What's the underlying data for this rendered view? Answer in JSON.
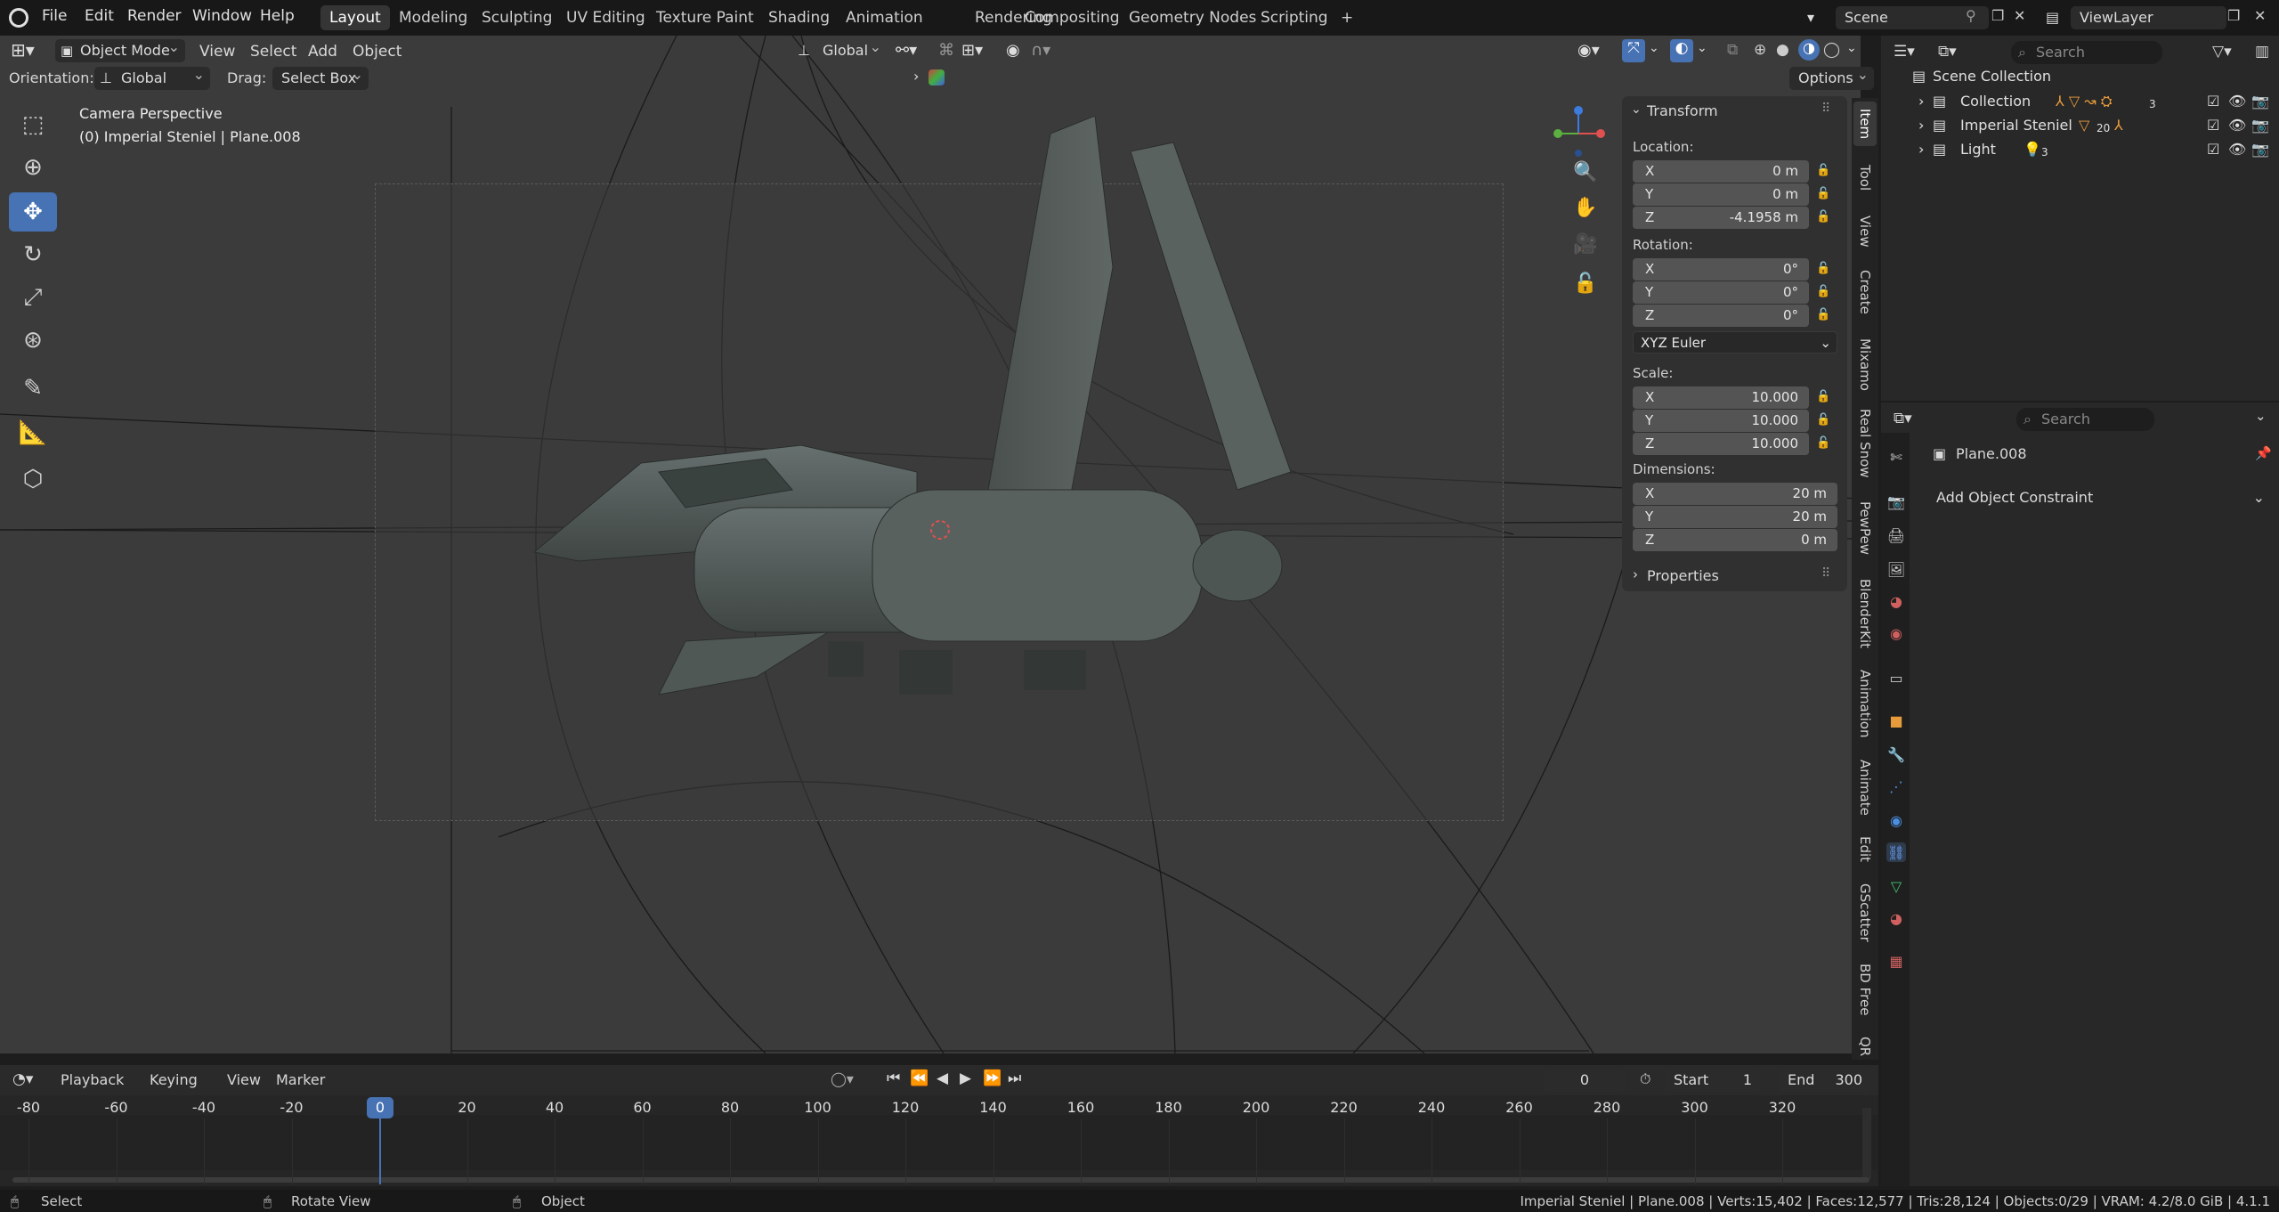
{
  "menu": {
    "items": [
      "File",
      "Edit",
      "Render",
      "Window",
      "Help"
    ],
    "workspaces": [
      "Layout",
      "Modeling",
      "Sculpting",
      "UV Editing",
      "Texture Paint",
      "Shading",
      "Animation",
      "Rendering",
      "Compositing",
      "Geometry Nodes",
      "Scripting"
    ],
    "active_workspace": "Layout",
    "add_tab": "+",
    "scene": "Scene",
    "view_layer": "ViewLayer"
  },
  "viewport_header": {
    "mode": "Object Mode",
    "menus": [
      "View",
      "Select",
      "Add",
      "Object"
    ],
    "transform_orientation": "Global",
    "orientation_label": "Orientation:",
    "orientation_value": "Global",
    "drag_label": "Drag:",
    "drag_value": "Select Box",
    "options": "Options"
  },
  "viewport": {
    "camera_label": "Camera Perspective",
    "object_label": "(0) Imperial Steniel | Plane.008"
  },
  "npanel": {
    "transform_title": "Transform",
    "location_label": "Location:",
    "location": [
      {
        "axis": "X",
        "value": "0 m"
      },
      {
        "axis": "Y",
        "value": "0 m"
      },
      {
        "axis": "Z",
        "value": "-4.1958 m"
      }
    ],
    "rotation_label": "Rotation:",
    "rotation": [
      {
        "axis": "X",
        "value": "0°"
      },
      {
        "axis": "Y",
        "value": "0°"
      },
      {
        "axis": "Z",
        "value": "0°"
      }
    ],
    "rotation_mode": "XYZ Euler",
    "scale_label": "Scale:",
    "scale": [
      {
        "axis": "X",
        "value": "10.000"
      },
      {
        "axis": "Y",
        "value": "10.000"
      },
      {
        "axis": "Z",
        "value": "10.000"
      }
    ],
    "dimensions_label": "Dimensions:",
    "dimensions": [
      {
        "axis": "X",
        "value": "20 m"
      },
      {
        "axis": "Y",
        "value": "20 m"
      },
      {
        "axis": "Z",
        "value": "0 m"
      }
    ],
    "properties_title": "Properties"
  },
  "vertical_tabs": [
    "Item",
    "Tool",
    "View",
    "Create",
    "Mixamo",
    "Real Snow",
    "PewPew",
    "BlenderKit",
    "Animation",
    "Animate",
    "Edit",
    "GScatter",
    "BD Free",
    "QR"
  ],
  "outliner": {
    "search_placeholder": "Search",
    "root": "Scene Collection",
    "rows": [
      {
        "name": "Collection",
        "count": "3"
      },
      {
        "name": "Imperial Steniel",
        "count": "20"
      },
      {
        "name": "Light",
        "count": "3"
      }
    ]
  },
  "properties": {
    "search_placeholder": "Search",
    "object_name": "Plane.008",
    "add_constraint": "Add Object Constraint"
  },
  "timeline": {
    "menus": [
      "Playback",
      "Keying",
      "View",
      "Marker"
    ],
    "current_frame": "0",
    "start_label": "Start",
    "start": "1",
    "end_label": "End",
    "end": "300",
    "ticks": [
      "-80",
      "-60",
      "-40",
      "-20",
      "0",
      "20",
      "40",
      "60",
      "80",
      "100",
      "120",
      "140",
      "160",
      "180",
      "200",
      "220",
      "240",
      "260",
      "280",
      "300",
      "320"
    ]
  },
  "statusbar": {
    "select": "Select",
    "rotate": "Rotate View",
    "object": "Object",
    "stats": "Imperial Steniel | Plane.008 | Verts:15,402 | Faces:12,577 | Tris:28,124 | Objects:0/29 | VRAM: 4.2/8.0 GiB | 4.1.1"
  },
  "colors": {
    "accent": "#4772b3",
    "bg": "#1d1d1d"
  }
}
